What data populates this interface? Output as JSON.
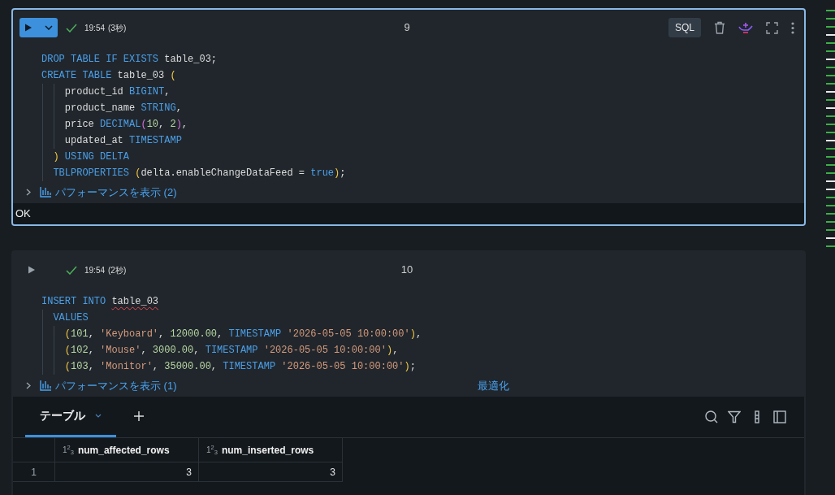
{
  "cells": [
    {
      "selected": true,
      "time": "19:54",
      "duration": "(3秒)",
      "number": "9",
      "language": "SQL",
      "code": [
        {
          "tokens": [
            {
              "t": "DROP TABLE IF EXISTS",
              "kind": "kw"
            },
            {
              "t": " table_03;",
              "kind": "id"
            }
          ]
        },
        {
          "tokens": [
            {
              "t": "CREATE TABLE",
              "kind": "kw"
            },
            {
              "t": " table_03 ",
              "kind": "id"
            },
            {
              "t": "(",
              "kind": "p1"
            }
          ]
        },
        {
          "tokens": [
            {
              "t": "    product_id ",
              "kind": "id"
            },
            {
              "t": "BIGINT",
              "kind": "kw"
            },
            {
              "t": ",",
              "kind": "id"
            }
          ]
        },
        {
          "tokens": [
            {
              "t": "    product_name ",
              "kind": "id"
            },
            {
              "t": "STRING",
              "kind": "kw"
            },
            {
              "t": ",",
              "kind": "id"
            }
          ]
        },
        {
          "tokens": [
            {
              "t": "    price ",
              "kind": "id"
            },
            {
              "t": "DECIMAL",
              "kind": "kw"
            },
            {
              "t": "(",
              "kind": "p2"
            },
            {
              "t": "10",
              "kind": "num"
            },
            {
              "t": ", ",
              "kind": "id"
            },
            {
              "t": "2",
              "kind": "num"
            },
            {
              "t": ")",
              "kind": "p2"
            },
            {
              "t": ",",
              "kind": "id"
            }
          ]
        },
        {
          "tokens": [
            {
              "t": "    updated_at ",
              "kind": "id"
            },
            {
              "t": "TIMESTAMP",
              "kind": "kw"
            }
          ]
        },
        {
          "tokens": [
            {
              "t": "  )",
              "kind": "p1"
            },
            {
              "t": " USING DELTA",
              "kind": "kw"
            }
          ]
        },
        {
          "tokens": [
            {
              "t": "  TBLPROPERTIES ",
              "kind": "kw"
            },
            {
              "t": "(",
              "kind": "p1"
            },
            {
              "t": "delta.enableChangeDataFeed = ",
              "kind": "id"
            },
            {
              "t": "true",
              "kind": "kw"
            },
            {
              "t": ")",
              "kind": "p1"
            },
            {
              "t": ";",
              "kind": "id"
            }
          ]
        }
      ],
      "performance": "パフォーマンスを表示 (2)",
      "output": {
        "kind": "text",
        "text": "OK"
      }
    },
    {
      "selected": false,
      "time": "19:54",
      "duration": "(2秒)",
      "number": "10",
      "code": [
        {
          "tokens": [
            {
              "t": "INSERT INTO ",
              "kind": "kw"
            },
            {
              "t": "table_03",
              "kind": "id",
              "error": true
            }
          ]
        },
        {
          "tokens": [
            {
              "t": "  VALUES",
              "kind": "kw"
            }
          ]
        },
        {
          "tokens": [
            {
              "t": "    (",
              "kind": "p1"
            },
            {
              "t": "101",
              "kind": "num"
            },
            {
              "t": ", ",
              "kind": "id"
            },
            {
              "t": "'Keyboard'",
              "kind": "str"
            },
            {
              "t": ", ",
              "kind": "id"
            },
            {
              "t": "12000.00",
              "kind": "num"
            },
            {
              "t": ", ",
              "kind": "id"
            },
            {
              "t": "TIMESTAMP ",
              "kind": "kw"
            },
            {
              "t": "'2026-05-05 10:00:00'",
              "kind": "str"
            },
            {
              "t": ")",
              "kind": "p1"
            },
            {
              "t": ",",
              "kind": "id"
            }
          ]
        },
        {
          "tokens": [
            {
              "t": "    (",
              "kind": "p1"
            },
            {
              "t": "102",
              "kind": "num"
            },
            {
              "t": ", ",
              "kind": "id"
            },
            {
              "t": "'Mouse'",
              "kind": "str"
            },
            {
              "t": ", ",
              "kind": "id"
            },
            {
              "t": "3000.00",
              "kind": "num"
            },
            {
              "t": ", ",
              "kind": "id"
            },
            {
              "t": "TIMESTAMP ",
              "kind": "kw"
            },
            {
              "t": "'2026-05-05 10:00:00'",
              "kind": "str"
            },
            {
              "t": ")",
              "kind": "p1"
            },
            {
              "t": ",",
              "kind": "id"
            }
          ]
        },
        {
          "tokens": [
            {
              "t": "    (",
              "kind": "p1"
            },
            {
              "t": "103",
              "kind": "num"
            },
            {
              "t": ", ",
              "kind": "id"
            },
            {
              "t": "'Monitor'",
              "kind": "str"
            },
            {
              "t": ", ",
              "kind": "id"
            },
            {
              "t": "35000.00",
              "kind": "num"
            },
            {
              "t": ", ",
              "kind": "id"
            },
            {
              "t": "TIMESTAMP ",
              "kind": "kw"
            },
            {
              "t": "'2026-05-05 10:00:00'",
              "kind": "str"
            },
            {
              "t": ")",
              "kind": "p1"
            },
            {
              "t": ";",
              "kind": "id"
            }
          ]
        }
      ],
      "performance": "パフォーマンスを表示 (1)",
      "optimize_link": "最適化",
      "output": {
        "kind": "table",
        "tabs": [
          {
            "label": "テーブル",
            "selected": true
          }
        ],
        "columns": [
          {
            "type": "1$^{2}$$_{3}$",
            "name": "num_affected_rows"
          },
          {
            "type": "1$^{2}$$_{3}$",
            "name": "num_inserted_rows"
          }
        ],
        "rows": [
          {
            "number": "1",
            "cells": [
              "3",
              "3"
            ]
          }
        ]
      }
    }
  ]
}
